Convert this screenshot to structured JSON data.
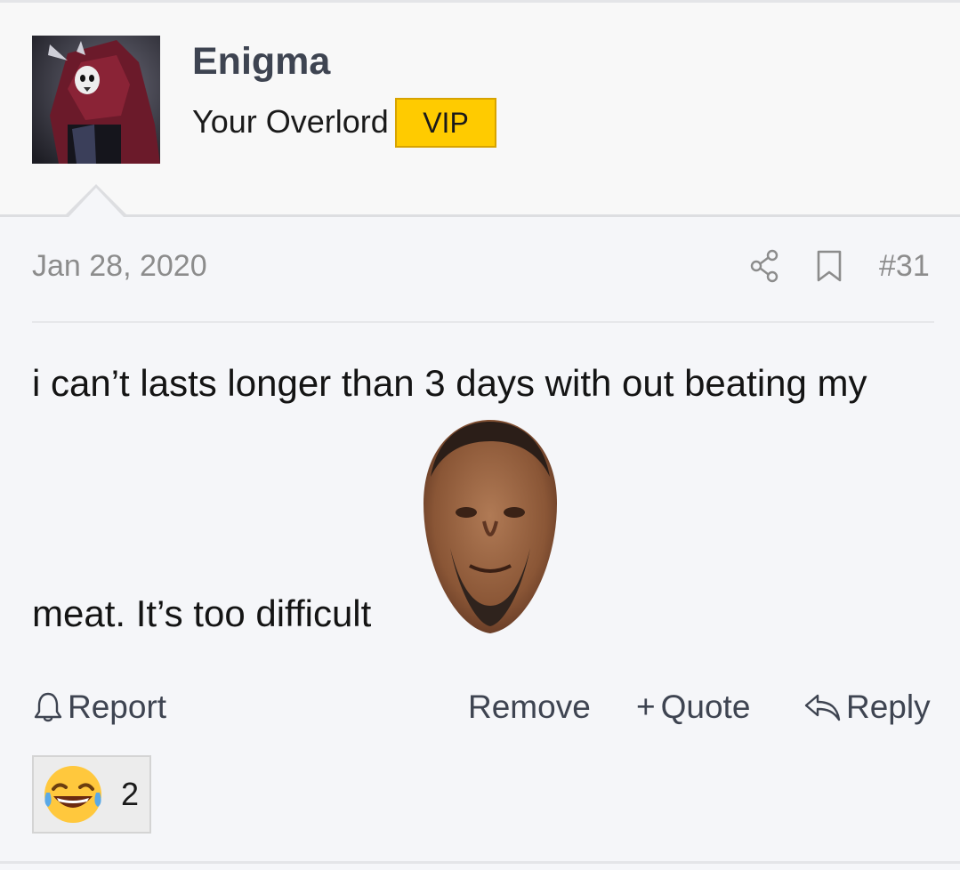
{
  "user": {
    "username": "Enigma",
    "title": "Your Overlord",
    "badge": "VIP",
    "badge_color": "#ffcb00"
  },
  "post": {
    "date": "Jan 28, 2020",
    "number": "#31",
    "body_line1": "i can’t lasts longer than 3 days with out beating my",
    "body_line2": "meat. It’s too difficult",
    "inline_image": "face-image"
  },
  "actions": {
    "report": "Report",
    "remove": "Remove",
    "quote": "Quote",
    "quote_prefix": "+",
    "reply": "Reply"
  },
  "reactions": [
    {
      "icon": "laughing-tears-emoji",
      "count": "2"
    }
  ],
  "icons": {
    "share": "share-icon",
    "bookmark": "bookmark-icon",
    "report": "bell-icon",
    "reply": "reply-arrow-icon"
  },
  "colors": {
    "username": "#3e4451",
    "meta": "#8c8c8c",
    "body_text": "#141414",
    "background": "#f5f6f9"
  }
}
